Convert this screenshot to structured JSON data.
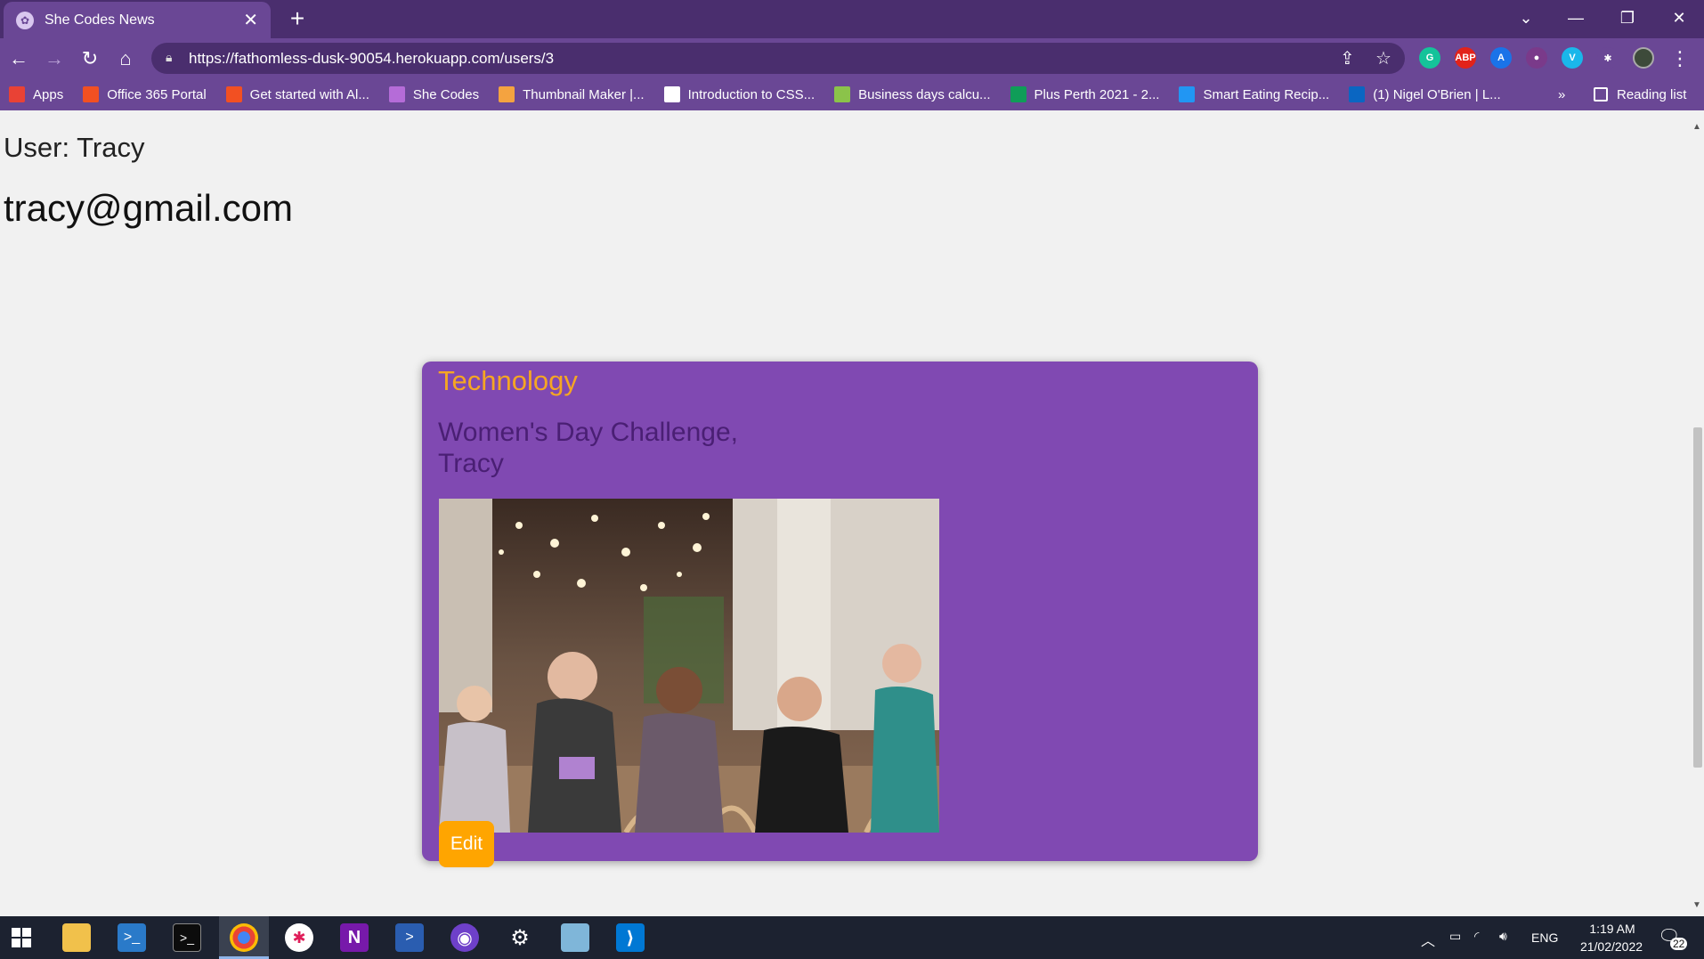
{
  "browser": {
    "tab_title": "She Codes News",
    "tab_close": "✕",
    "new_tab": "+",
    "url": "https://fathomless-dusk-90054.herokuapp.com/users/3",
    "bookmarks": [
      {
        "label": "Apps",
        "color": "#e94235"
      },
      {
        "label": "Office 365 Portal",
        "color": "#f25022"
      },
      {
        "label": "Get started with Al...",
        "color": "#f25022"
      },
      {
        "label": "She Codes",
        "color": "#b56cd8"
      },
      {
        "label": "Thumbnail Maker |...",
        "color": "#f4a340"
      },
      {
        "label": "Introduction to CSS...",
        "color": "#ffffff"
      },
      {
        "label": "Business days calcu...",
        "color": "#8bc34a"
      },
      {
        "label": "Plus Perth 2021 - 2...",
        "color": "#0f9d58"
      },
      {
        "label": "Smart Eating Recip...",
        "color": "#2196f3"
      },
      {
        "label": "(1) Nigel O'Brien | L...",
        "color": "#0a66c2"
      }
    ],
    "bookmarks_overflow": "»",
    "reading_list": "Reading list",
    "extensions": [
      {
        "name": "grammarly-icon",
        "text": "G",
        "color": "#15c39a"
      },
      {
        "name": "adblock-plus-icon",
        "text": "ABP",
        "color": "#e2231a"
      },
      {
        "name": "extension-blue-icon",
        "text": "A",
        "color": "#1a73e8"
      },
      {
        "name": "screen-recorder-icon",
        "text": "●",
        "color": "#7a3a8a"
      },
      {
        "name": "vimeo-icon",
        "text": "V",
        "color": "#1ab7ea"
      },
      {
        "name": "puzzle-extensions-icon",
        "text": "✱",
        "color": "#6a4795"
      }
    ]
  },
  "page": {
    "user_heading": "User: Tracy",
    "email": "tracy@gmail.com",
    "story": {
      "category": "Technology",
      "title": "Women's Day Challenge, Tracy",
      "edit_label": "Edit",
      "image_alt": "Event photo"
    }
  },
  "taskbar": {
    "apps": [
      "start-icon",
      "file-explorer-icon",
      "powershell-icon",
      "terminal-icon",
      "chrome-icon",
      "slack-icon",
      "onenote-icon",
      "powershell-ise-icon",
      "github-desktop-icon",
      "settings-icon",
      "notepad-icon",
      "vscode-icon"
    ],
    "language": "ENG",
    "time": "1:19 AM",
    "date": "21/02/2022",
    "notifications": "22"
  }
}
